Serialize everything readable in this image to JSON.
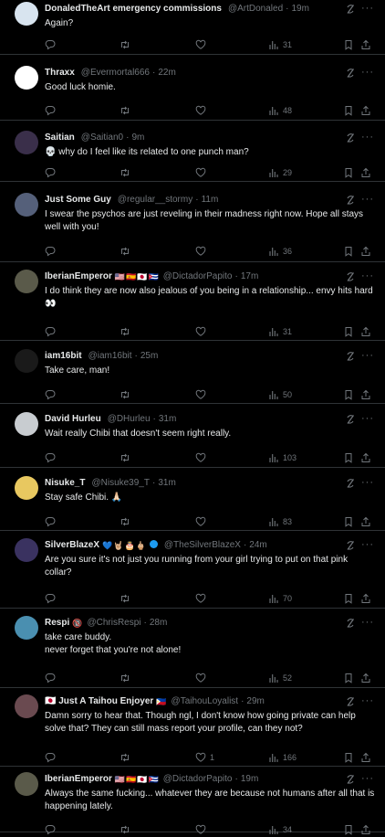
{
  "colors": {
    "background": "#000000",
    "text": "#e7e9ea",
    "muted": "#71767b",
    "divider": "#2f3336",
    "verified": "#1d9bf0"
  },
  "icons": {
    "reply": "reply-icon",
    "retweet": "retweet-icon",
    "like": "heart-icon",
    "views": "views-icon",
    "bookmark": "bookmark-icon",
    "share": "share-icon",
    "grok": "grok-icon",
    "more": "more-icon"
  },
  "tweets": [
    {
      "name": "DonaledTheArt emergency commissions",
      "badges": "",
      "handle": "@ArtDonaled",
      "time": "19m",
      "text": "Again?",
      "likes": "",
      "views": "31",
      "avatar_color": "#d8e4ef"
    },
    {
      "name": "Thraxx",
      "badges": "",
      "handle": "@Evermortal666",
      "time": "22m",
      "text": "Good luck homie.",
      "likes": "",
      "views": "48",
      "avatar_color": "#ffffff"
    },
    {
      "name": "Saitian",
      "badges": "",
      "handle": "@Saitian0",
      "time": "9m",
      "text": "💀 why do I feel like its related to one punch man?",
      "likes": "",
      "views": "29",
      "avatar_color": "#3a2f4a"
    },
    {
      "name": "Just Some Guy",
      "badges": "",
      "handle": "@regular__stormy",
      "time": "11m",
      "text": "I swear the psychos are just reveling in their madness right now. Hope all stays well with you!",
      "likes": "",
      "views": "36",
      "avatar_color": "#55607a"
    },
    {
      "name": "IberianEmperor",
      "badges": "🇺🇸🇪🇸🇯🇵🇨🇺",
      "handle": "@DictadorPapito",
      "time": "17m",
      "text": "I do think they are now also jealous of you being in a relationship... envy hits hard 👀",
      "likes": "",
      "views": "31",
      "avatar_color": "#5a5a4a"
    },
    {
      "name": "iam16bit",
      "badges": "",
      "handle": "@iam16bit",
      "time": "25m",
      "text": "Take care, man!",
      "likes": "",
      "views": "50",
      "avatar_color": "#1a1a1a"
    },
    {
      "name": "David Hurleu",
      "badges": "",
      "handle": "@DHurleu",
      "time": "31m",
      "text": "Wait really Chibi that doesn't seem right really.",
      "likes": "",
      "views": "103",
      "avatar_color": "#c8ccd0"
    },
    {
      "name": "Nisuke_T",
      "badges": "",
      "handle": "@Nisuke39_T",
      "time": "31m",
      "text": "Stay safe Chibi. 🙏🏻",
      "likes": "",
      "views": "83",
      "avatar_color": "#e8c860"
    },
    {
      "name": "SilverBlazeX",
      "badges": "💙🤘🏼🎂🖕🏼",
      "handle": "@TheSilverBlazeX",
      "time": "24m",
      "text": "Are you sure it's not just you running from your girl trying to put on that pink collar?",
      "likes": "",
      "views": "70",
      "avatar_color": "#3a3260"
    },
    {
      "name": "Respi",
      "badges": "🔞",
      "handle": "@ChrisRespi",
      "time": "28m",
      "text": "take care buddy.\nnever forget that you're not alone!",
      "likes": "",
      "views": "52",
      "avatar_color": "#4a8fb0"
    },
    {
      "name": "🇯🇵 Just A Taihou Enjoyer",
      "badges": "🇵🇭",
      "handle": "@TaihouLoyalist",
      "time": "29m",
      "text": "Damn sorry to hear that. Though ngl, I don't know how going private can help solve that? They can still mass report your profile, can they not?",
      "likes": "1",
      "views": "166",
      "avatar_color": "#6a4a50"
    },
    {
      "name": "IberianEmperor",
      "badges": "🇺🇸🇪🇸🇯🇵🇨🇺",
      "handle": "@DictadorPapito",
      "time": "19m",
      "text": "Always the same fucking... whatever they are because not humans after all that is happening lately.",
      "likes": "",
      "views": "34",
      "avatar_color": "#5a5a4a"
    }
  ]
}
